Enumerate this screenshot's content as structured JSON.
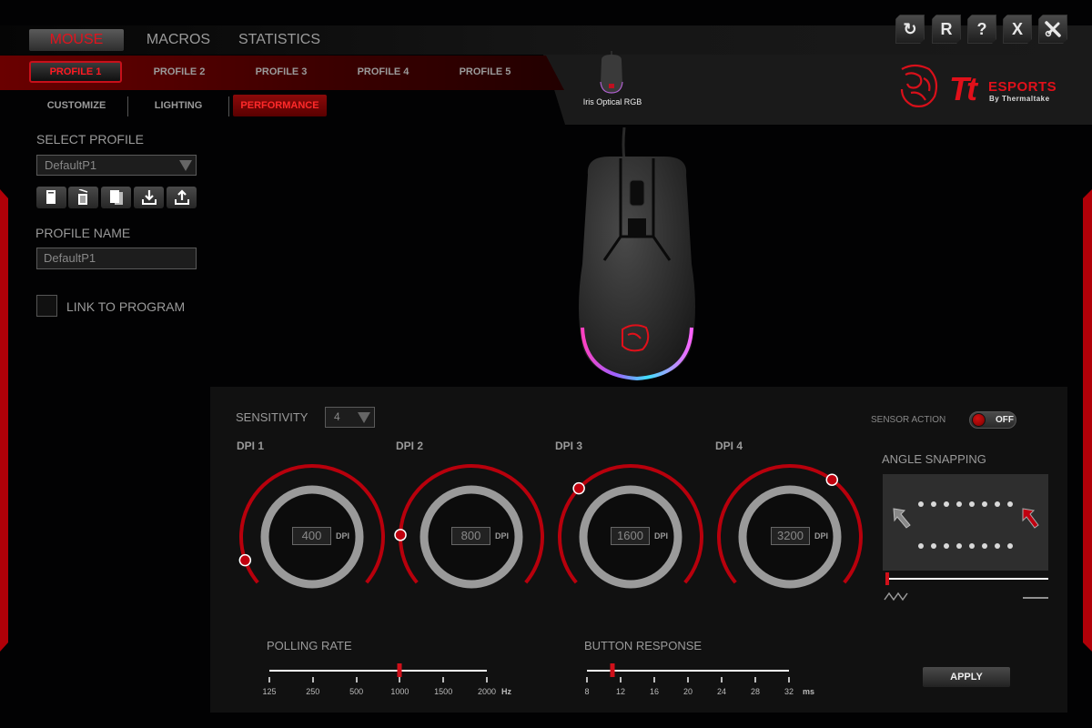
{
  "main_tabs": [
    {
      "label": "MOUSE",
      "active": true
    },
    {
      "label": "MACROS",
      "active": false
    },
    {
      "label": "STATISTICS",
      "active": false
    }
  ],
  "profile_tabs": [
    {
      "label": "PROFILE 1",
      "active": true
    },
    {
      "label": "PROFILE 2",
      "active": false
    },
    {
      "label": "PROFILE 3",
      "active": false
    },
    {
      "label": "PROFILE 4",
      "active": false
    },
    {
      "label": "PROFILE 5",
      "active": false
    }
  ],
  "sub_tabs": [
    {
      "label": "CUSTOMIZE",
      "active": false
    },
    {
      "label": "LIGHTING",
      "active": false
    },
    {
      "label": "PERFORMANCE",
      "active": true
    }
  ],
  "toolbar": [
    {
      "icon": "refresh-icon",
      "glyph": "↻"
    },
    {
      "icon": "reset-icon",
      "glyph": "R"
    },
    {
      "icon": "help-icon",
      "glyph": "?"
    },
    {
      "icon": "close-icon",
      "glyph": "X"
    },
    {
      "icon": "tools-icon",
      "glyph": "✕"
    }
  ],
  "device": {
    "name": "Iris Optical RGB"
  },
  "brand": {
    "logo_main": "Tt",
    "logo_sub": "ESPORTS",
    "logo_by": "By Thermaltake",
    "accent": "#e0101a"
  },
  "left_panel": {
    "select_profile_label": "SELECT PROFILE",
    "selected_profile": "DefaultP1",
    "profile_actions": [
      "new-profile-icon",
      "delete-icon",
      "copy-icon",
      "import-icon",
      "export-icon"
    ],
    "profile_name_label": "PROFILE NAME",
    "profile_name_value": "DefaultP1",
    "link_label": "LINK TO PROGRAM",
    "link_checked": false
  },
  "performance": {
    "sensitivity_label": "SENSITIVITY",
    "sensitivity_value": "4",
    "dpi_unit": "DPI",
    "dpi_range": {
      "min": 0,
      "max": 5000
    },
    "dpi_stages": [
      {
        "label": "DPI 1",
        "value": 400
      },
      {
        "label": "DPI 2",
        "value": 800
      },
      {
        "label": "DPI 3",
        "value": 1600
      },
      {
        "label": "DPI 4",
        "value": 3200
      }
    ],
    "sensor_action_label": "SENSOR ACTION",
    "sensor_action_state": "OFF",
    "angle_snapping_label": "ANGLE SNAPPING",
    "angle_snapping_level": 0,
    "polling_rate": {
      "label": "POLLING RATE",
      "ticks": [
        "125",
        "250",
        "500",
        "1000",
        "1500",
        "2000"
      ],
      "unit": "Hz",
      "selected_index": 3
    },
    "button_response": {
      "label": "BUTTON RESPONSE",
      "ticks": [
        "8",
        "12",
        "16",
        "20",
        "24",
        "28",
        "32"
      ],
      "unit": "ms",
      "value": 11,
      "min": 8,
      "max": 32
    },
    "apply_label": "APPLY"
  }
}
